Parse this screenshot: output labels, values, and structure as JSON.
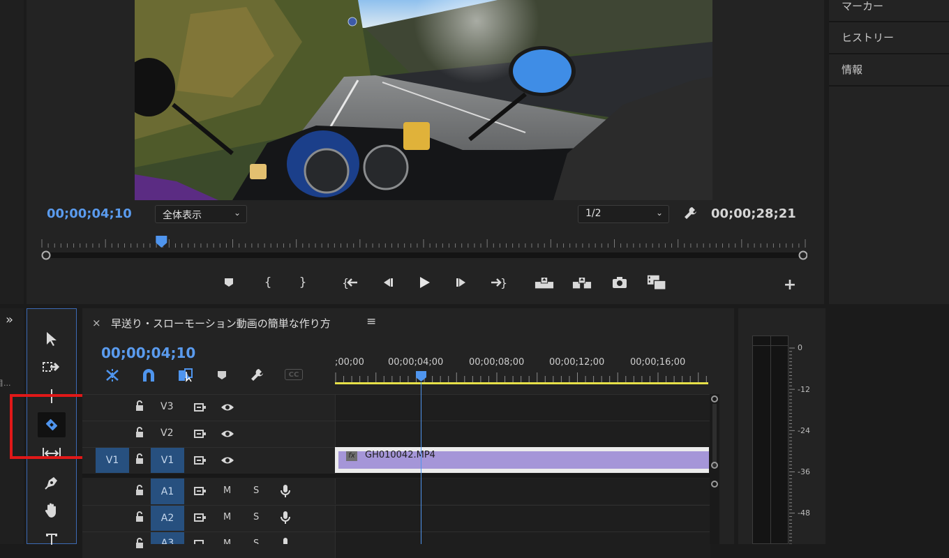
{
  "right_panel": {
    "items": [
      {
        "label": "マーカー"
      },
      {
        "label": "ヒストリー"
      },
      {
        "label": "情報"
      }
    ]
  },
  "program_monitor": {
    "current_timecode": "00;00;04;10",
    "zoom_select": "全体表示",
    "resolution_select": "1/2",
    "duration_timecode": "00;00;28;21"
  },
  "transport": {
    "buttons": [
      "marker-icon",
      "mark-in-icon",
      "mark-out-icon",
      "go-to-in-icon",
      "step-back-icon",
      "play-icon",
      "step-forward-icon",
      "go-to-out-icon",
      "lift-icon",
      "extract-icon",
      "camera-icon",
      "comparison-icon",
      "add-button-icon"
    ]
  },
  "sequence": {
    "title": "早送り・スローモーション動画の簡単な作り方",
    "close_label": "×",
    "menu_label": "≡",
    "timecode": "00;00;04;10",
    "ruler_labels": [
      ";00;00",
      "00;00;04;00",
      "00;00;08;00",
      "00;00;12;00",
      "00;00;16;00"
    ],
    "cc_label": "CC",
    "playhead_progress": 0.27
  },
  "tracks": {
    "video": [
      {
        "name": "V3",
        "source": ""
      },
      {
        "name": "V2",
        "source": ""
      },
      {
        "name": "V1",
        "source": "V1"
      }
    ],
    "audio": [
      {
        "name": "A1",
        "mute": "M",
        "solo": "S"
      },
      {
        "name": "A2",
        "mute": "M",
        "solo": "S"
      },
      {
        "name": "A3",
        "mute": "M",
        "solo": "S"
      }
    ]
  },
  "clip": {
    "name": "GH010042.MP4",
    "fx": "fx",
    "color": "#a596d8"
  },
  "left_edge": {
    "expand_label": "»",
    "truncated_label": "目..."
  },
  "audio_meter": {
    "labels": [
      "0",
      "-12",
      "-24",
      "-36",
      "-48"
    ]
  },
  "colors": {
    "accent": "#5a9bee",
    "highlight_red": "#e01818",
    "work_area": "#e6e048"
  }
}
